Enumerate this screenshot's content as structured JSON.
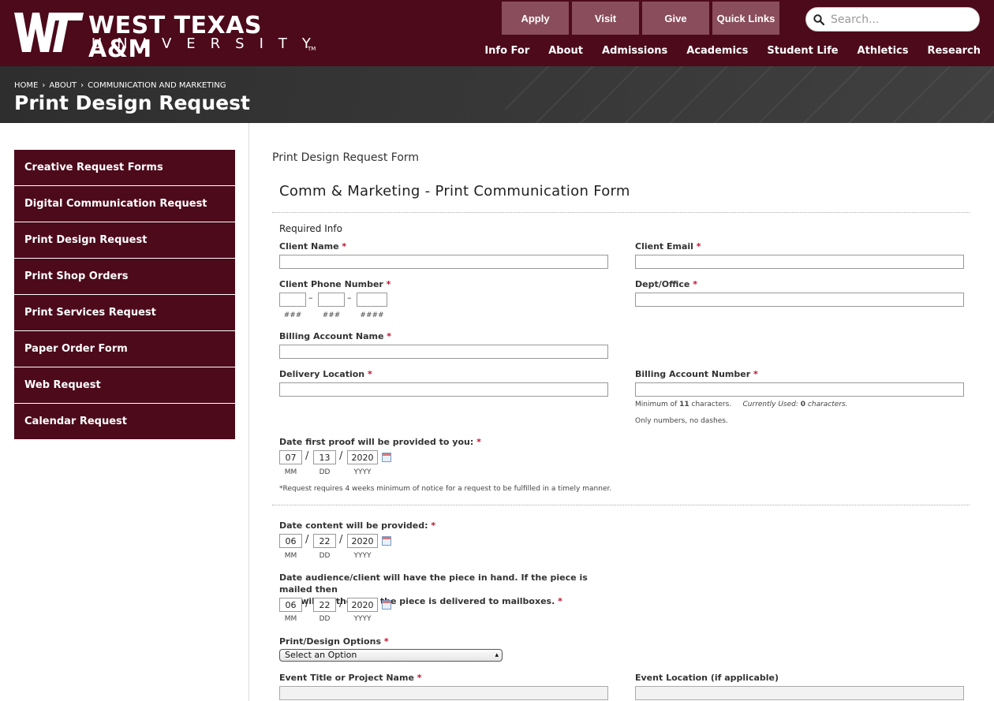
{
  "header": {
    "logo_name": "WEST TEXAS A&M",
    "logo_sub": "UNIVERSITY",
    "logo_tm": "TM",
    "quick": [
      "Apply",
      "Visit",
      "Give",
      "Quick Links"
    ],
    "search_placeholder": "Search...",
    "nav": [
      "Info For",
      "About",
      "Admissions",
      "Academics",
      "Student Life",
      "Athletics",
      "Research"
    ]
  },
  "hero": {
    "breadcrumb": [
      "HOME",
      "ABOUT",
      "COMMUNICATION AND MARKETING"
    ],
    "title": "Print Design Request"
  },
  "sidebar": {
    "items": [
      "Creative Request Forms",
      "Digital Communication Request",
      "Print Design Request",
      "Print Shop Orders",
      "Print Services Request",
      "Paper Order Form",
      "Web Request",
      "Calendar Request"
    ]
  },
  "form": {
    "caption": "Print Design Request Form",
    "title": "Comm & Marketing - Print Communication Form",
    "section": "Required Info",
    "client_name": "Client Name",
    "client_email": "Client Email",
    "client_phone": "Client Phone Number",
    "dept_office": "Dept/Office",
    "phone_sub": [
      "###",
      "###",
      "####"
    ],
    "phone_sep": "–",
    "billing_account_name": "Billing Account Name",
    "delivery_location": "Delivery Location",
    "billing_account_number": "Billing Account Number",
    "billing_note_min": "Minimum of",
    "billing_note_min_n": "11",
    "billing_note_chars": "characters.",
    "billing_note_used": "Currently Used:",
    "billing_note_used_n": "0",
    "billing_note_used_chars": "characters.",
    "billing_note_only": "Only numbers, no dashes.",
    "proof_date_label": "Date first proof will be provided to you:",
    "proof_date": [
      "07",
      "13",
      "2020"
    ],
    "date_sub": [
      "MM",
      "DD",
      "YYYY"
    ],
    "date_sep": "/",
    "notice": "*Request requires 4 weeks minimum of notice for a request to be fulfilled in a timely manner.",
    "content_date_label": "Date content will be provided:",
    "content_date": [
      "06",
      "22",
      "2020"
    ],
    "audience_label_1": "Date audience/client will have the piece in hand. If the piece is mailed then",
    "audience_label_2": "this will be the date the piece is delivered to mailboxes.",
    "audience_date": [
      "06",
      "22",
      "2020"
    ],
    "options_label": "Print/Design Options",
    "options_value": "Select an Option",
    "event_title": "Event Title or Project Name",
    "event_location": "Event Location (if applicable)",
    "required_mark": "*"
  },
  "colors": {
    "maroon": "#4c0a1b",
    "button": "#8a4d5c",
    "hero": "#363636",
    "required": "#c0102c"
  }
}
